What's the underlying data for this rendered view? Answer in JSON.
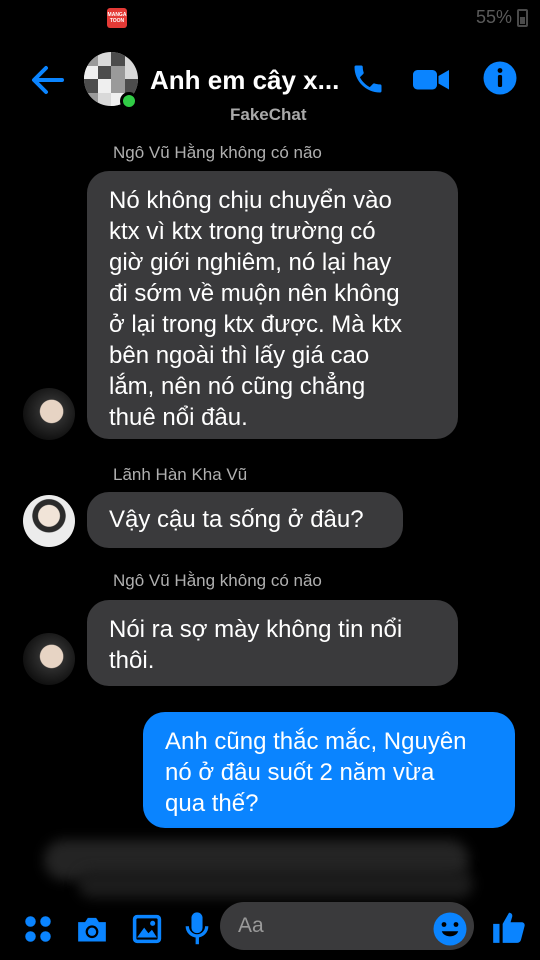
{
  "status_bar": {
    "app_badge": "MANGA TOON",
    "battery": "55%"
  },
  "header": {
    "title": "Anh em cây x...",
    "subtitle": "FakeChat"
  },
  "messages": [
    {
      "sender": "Ngô Vũ Hằng không có não",
      "text": "Nó không chịu chuyển vào\nktx vì ktx trong trường có\ngiờ giới nghiêm, nó lại hay\nđi sớm về muộn nên không\nở lại trong ktx được. Mà ktx\nbên ngoài thì lấy giá cao\nlắm, nên nó cũng chẳng\nthuê nổi đâu."
    },
    {
      "sender": "Lãnh Hàn Kha Vũ",
      "text": "Vậy cậu ta sống ở đâu?"
    },
    {
      "sender": "Ngô Vũ Hằng không có não",
      "text": "Nói ra sợ mày không tin nổi\nthôi."
    },
    {
      "sender": "",
      "text": "Anh cũng thắc mắc, Nguyên\nnó ở đâu suốt 2 năm vừa\nqua thế?"
    }
  ],
  "composer": {
    "placeholder": "Aa"
  },
  "colors": {
    "accent": "#0a84ff",
    "bubble_other": "#3a3a3c",
    "online": "#31cc46"
  },
  "icons": [
    "back-arrow-icon",
    "phone-icon",
    "video-camera-icon",
    "info-icon",
    "apps-icon",
    "camera-icon",
    "gallery-icon",
    "microphone-icon",
    "emoji-icon",
    "thumbs-up-icon"
  ]
}
